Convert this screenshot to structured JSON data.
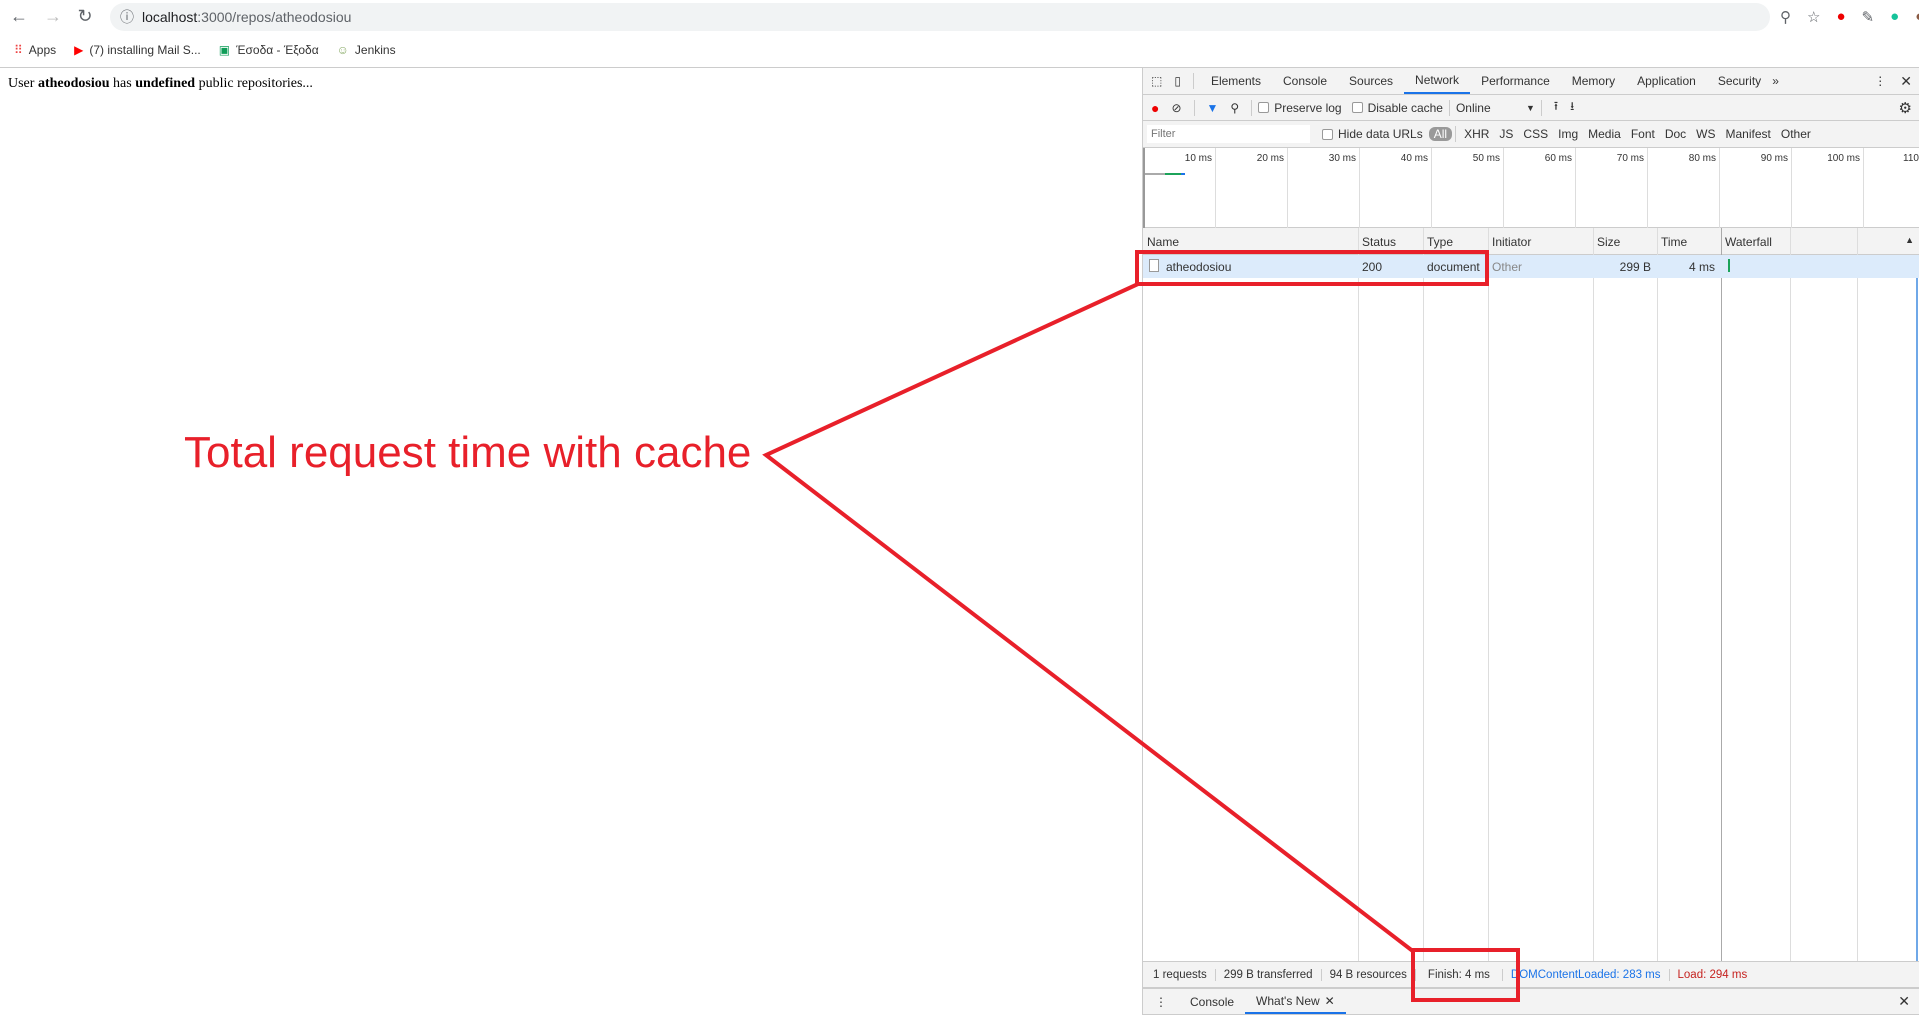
{
  "browser": {
    "url_host": "localhost",
    "url_path": ":3000/repos/atheodosiou",
    "bookmarks": [
      "Apps",
      "(7) installing Mail S...",
      "Έσοδα - Έξοδα",
      "Jenkins"
    ]
  },
  "page": {
    "t1": "User ",
    "user": "atheodosiou",
    "t2": " has ",
    "count": "undefined",
    "t3": " public repositories..."
  },
  "devtools": {
    "tabs": [
      "Elements",
      "Console",
      "Sources",
      "Network",
      "Performance",
      "Memory",
      "Application",
      "Security"
    ],
    "toolbar": {
      "preserve_log": "Preserve log",
      "disable_cache": "Disable cache",
      "throttle": "Online"
    },
    "filter": {
      "placeholder": "Filter",
      "hide_data_urls": "Hide data URLs",
      "types": [
        "All",
        "XHR",
        "JS",
        "CSS",
        "Img",
        "Media",
        "Font",
        "Doc",
        "WS",
        "Manifest",
        "Other"
      ]
    },
    "overview_ticks": [
      "10 ms",
      "20 ms",
      "30 ms",
      "40 ms",
      "50 ms",
      "60 ms",
      "70 ms",
      "80 ms",
      "90 ms",
      "100 ms",
      "110"
    ],
    "columns": [
      "Name",
      "Status",
      "Type",
      "Initiator",
      "Size",
      "Time",
      "Waterfall"
    ],
    "rows": [
      {
        "name": "atheodosiou",
        "status": "200",
        "type": "document",
        "initiator": "Other",
        "size": "299 B",
        "time": "4 ms"
      }
    ],
    "status": {
      "requests": "1 requests",
      "transferred": "299 B transferred",
      "resources": "94 B resources",
      "finish": "Finish: 4 ms",
      "dcl": "DOMContentLoaded: 283 ms",
      "load": "Load: 294 ms"
    },
    "drawer": [
      "Console",
      "What's New"
    ]
  },
  "annotation": "Total request time with cache",
  "colors": {
    "annotation": "#e8202a",
    "dcl": "#1a73e8",
    "load": "#c5221f"
  }
}
